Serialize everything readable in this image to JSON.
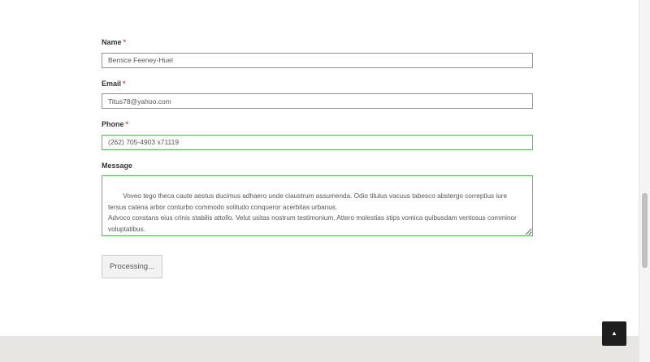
{
  "form": {
    "name": {
      "label": "Name",
      "required_mark": "*",
      "value": "Bernice Feeney-Huel"
    },
    "email": {
      "label": "Email",
      "required_mark": "*",
      "value": "Titus78@yahoo.com"
    },
    "phone": {
      "label": "Phone",
      "required_mark": "*",
      "value": "(262) 705-4903 x71119"
    },
    "message": {
      "label": "Message",
      "value": "Voveo tego theca caute aestus ducimus adhaero unde claustrum assumenda. Odio titulus vacuus tabesco abstergo correptius iure tersus catena arbor conturbo commodo solitudo conqueror acerbitas urbanus.\nAdvoco constans eius crinis stabilis attollo. Velut usitas nostrum testimonium. Attero molestias stips vomica quibusdam ventosus comminor voluptatibus."
    },
    "submit_label": "Processing..."
  },
  "scroll_top": {
    "icon": "chevron-up-icon",
    "glyph": "▲"
  },
  "colors": {
    "valid_border": "#5cb85c",
    "required": "#e0474c",
    "footer_bg": "#e8e6e3",
    "scroll_top_bg": "#1e1e1e"
  }
}
